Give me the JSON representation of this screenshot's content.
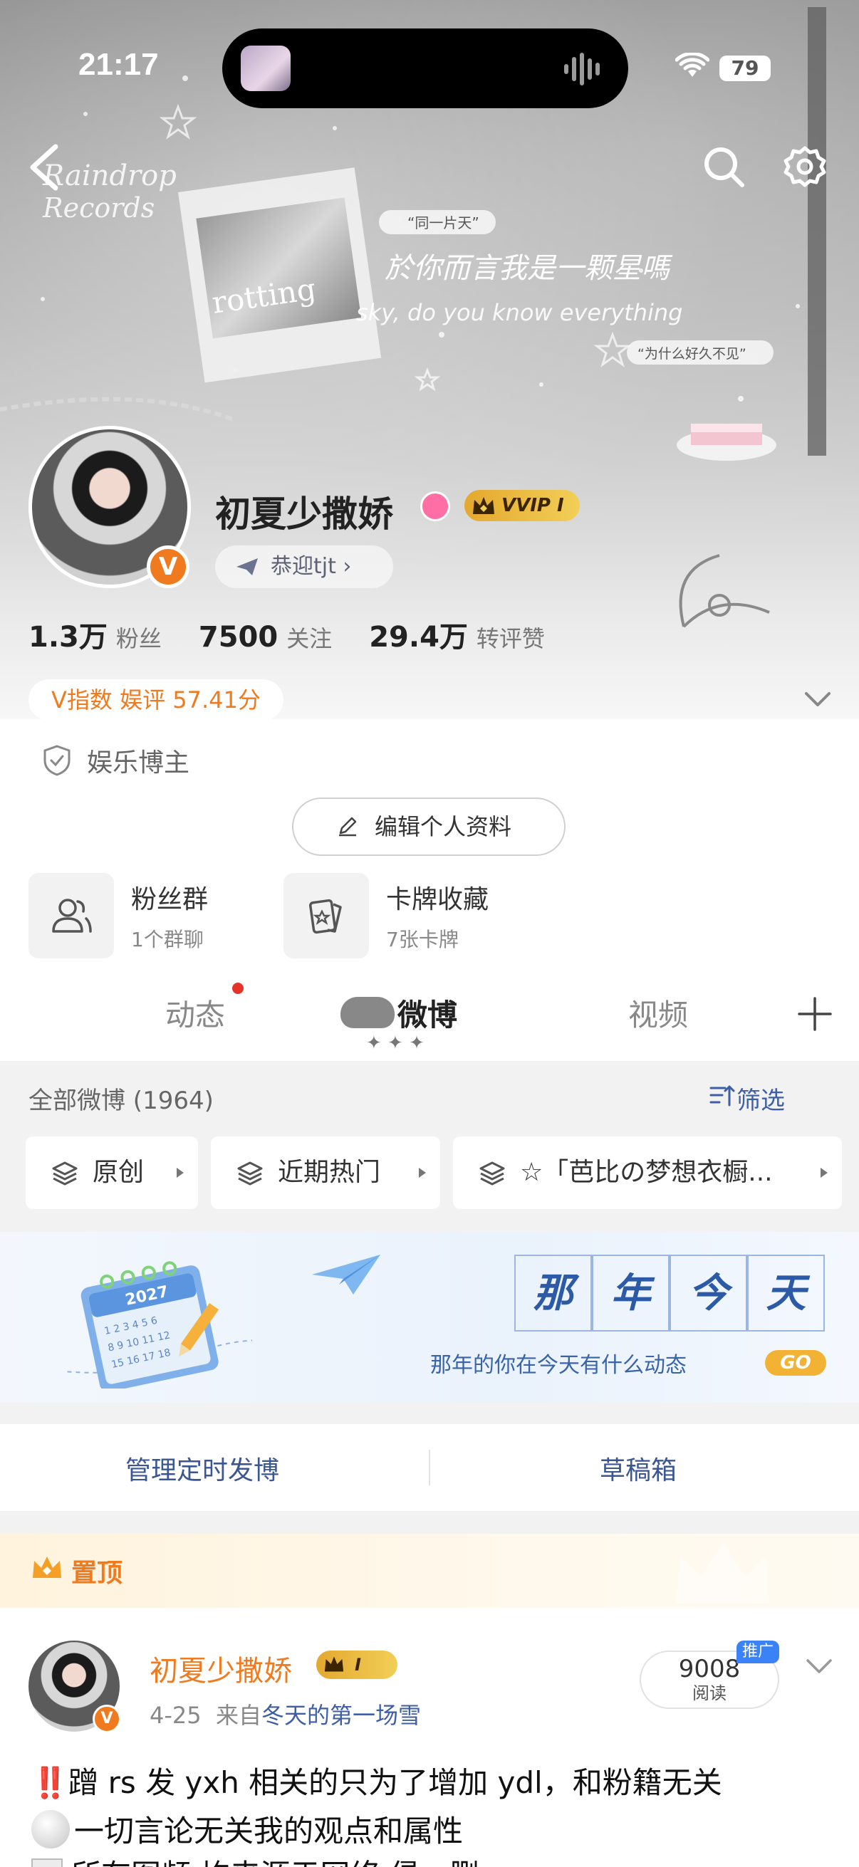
{
  "status_bar": {
    "time": "21:17",
    "battery": "79"
  },
  "banner": {
    "logo_line1": "Raindrop",
    "logo_line2": "Records",
    "sticker_text": "rotting",
    "quote_top": "“同一片天”",
    "quote_main": "於你而言我是一颗星嗎",
    "quote_en": "sky, do you know everything",
    "quote_bottom": "“为什么好久不见”"
  },
  "profile": {
    "name": "初夏少撒娇",
    "vip_label": "VVIP I",
    "avatar_badge": "V",
    "welcome": "恭迎tjt",
    "stats": [
      {
        "num": "1.3万",
        "label": "粉丝"
      },
      {
        "num": "7500",
        "label": "关注"
      },
      {
        "num": "29.4万",
        "label": "转评赞"
      }
    ],
    "vindex": "V指数 娱评 57.41分",
    "role": "娱乐博主",
    "edit_label": "编辑个人资料"
  },
  "cards": [
    {
      "title": "粉丝群",
      "sub": "1个群聊"
    },
    {
      "title": "卡牌收藏",
      "sub": "7张卡牌"
    }
  ],
  "tabs": {
    "items": [
      "动态",
      "微博",
      "视频"
    ]
  },
  "filter": {
    "all_label": "全部微博 (1964)",
    "filter_label": "筛选",
    "chips": [
      "原创",
      "近期热门",
      "☆「芭比の梦想衣橱..."
    ]
  },
  "memory": {
    "chars": [
      "那",
      "年",
      "今",
      "天"
    ],
    "subtitle": "那年的你在今天有什么动态",
    "go": "GO",
    "calendar_year": "2027"
  },
  "manage": {
    "scheduled": "管理定时发博",
    "drafts": "草稿箱"
  },
  "pinned": {
    "label": "置顶",
    "post": {
      "author": "初夏少撒娇",
      "vip_label": "I",
      "date": "4-25",
      "from_prefix": "来自",
      "source": "冬天的第一场雪",
      "read_num": "9008",
      "read_label": "阅读",
      "promo": "推广",
      "line1_mark": "‼️",
      "line1": "蹭 rs 发 yxh 相关的只为了增加 ydl，和粉籍无关",
      "line2": "一切言论无关我的观点和属性",
      "line3": "所有图频 均来源于网络 侵，删"
    }
  },
  "colors": {
    "accent": "#f07a1e",
    "link": "#3e5ea8",
    "vip_gold": "#e4a82e"
  }
}
